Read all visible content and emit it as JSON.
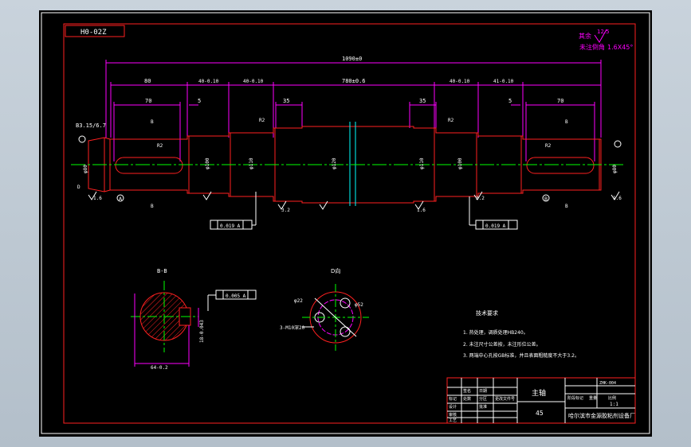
{
  "drawing": {
    "sheet_code": "H0-02Z",
    "roughness": {
      "value": "12.5",
      "label": "其余",
      "chamfer_note": "未注倒角",
      "chamfer_value": "1.6X45°"
    },
    "overall_length": "1090±0",
    "segment_lengths": [
      "80",
      "40-0.10",
      "40-0.10",
      "780±0.6",
      "40-0.10",
      "41-0.10"
    ],
    "key_lengths": [
      "70",
      "70"
    ],
    "small_widths": [
      "5",
      "5"
    ],
    "shoulder_widths": [
      "35",
      "35"
    ],
    "diameters": [
      "φ80",
      "φ100",
      "φ110",
      "φ120",
      "φ110",
      "φ100",
      "φ80"
    ],
    "radius_labels": [
      "R2",
      "R2",
      "R2",
      "R2"
    ],
    "center_hole": "B3.15/6.7",
    "section_letters": [
      "B",
      "D",
      "B",
      "B",
      "B"
    ],
    "datum_labels": [
      "A",
      "B"
    ],
    "tolerance_frames": [
      "0.019 A",
      "0.019 A",
      "0.005 A"
    ],
    "roughness_marks": [
      "1.6",
      "3.2",
      "1.6",
      "3.2",
      "1.6"
    ],
    "section_b": {
      "title": "B-B",
      "dims": [
        "64-0.2",
        "18-0.043"
      ]
    },
    "view_d": {
      "title": "D向",
      "hole_callout": "3-M10深20",
      "dims": [
        "φ22",
        "φ52"
      ]
    },
    "tech_requirements": {
      "title": "技术要求",
      "items": [
        "1. 热处理，调质处理HB240。",
        "2. 未注尺寸公差按，未注形位公差。",
        "3. 两端中心孔按GB标准，并且表面粗糙度不大于3.2。"
      ]
    },
    "title_block": {
      "part_name": "主轴",
      "material": "45",
      "scale": "1:1",
      "company": "哈尔滨市金源胶粘剂设备厂",
      "left_labels": [
        "标记",
        "处数",
        "分区",
        "更改文件号",
        "签名",
        "日期"
      ],
      "role_labels": [
        "设计",
        "审核",
        "工艺",
        "批准"
      ],
      "right_labels": [
        "阶段标记",
        "重量",
        "比例"
      ],
      "drawing_no": "ZHK-004"
    }
  }
}
